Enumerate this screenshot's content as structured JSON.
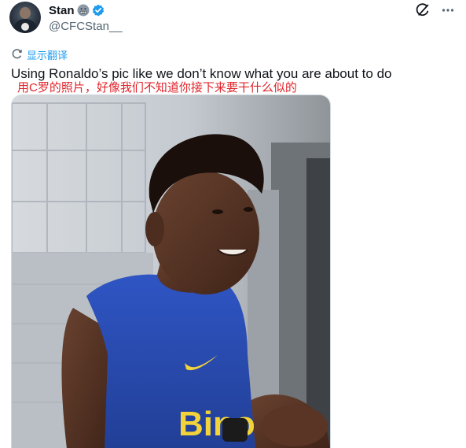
{
  "tweet": {
    "author_name": "Stan",
    "author_handle": "@CFCStan__",
    "verified": true,
    "name_emoji": "grimacing-face",
    "text": "Using Ronaldo’s pic like we don’t know what you are about to do",
    "translated_text": "用C罗的照片，好像我们不知道你接下来要干什么似的",
    "translate_label": "显示翻译"
  },
  "icons": {
    "translate": "translate-icon",
    "grok": "grok-icon",
    "more": "more-icon",
    "verified": "verified-badge-icon"
  },
  "colors": {
    "accent": "#1d9bf0",
    "translation_text": "#e0242b",
    "jersey": "#2d4fb8",
    "sponsor_text": "#f2d33a"
  },
  "media": {
    "sponsor_text": "Bino",
    "alt_description": "photo"
  }
}
